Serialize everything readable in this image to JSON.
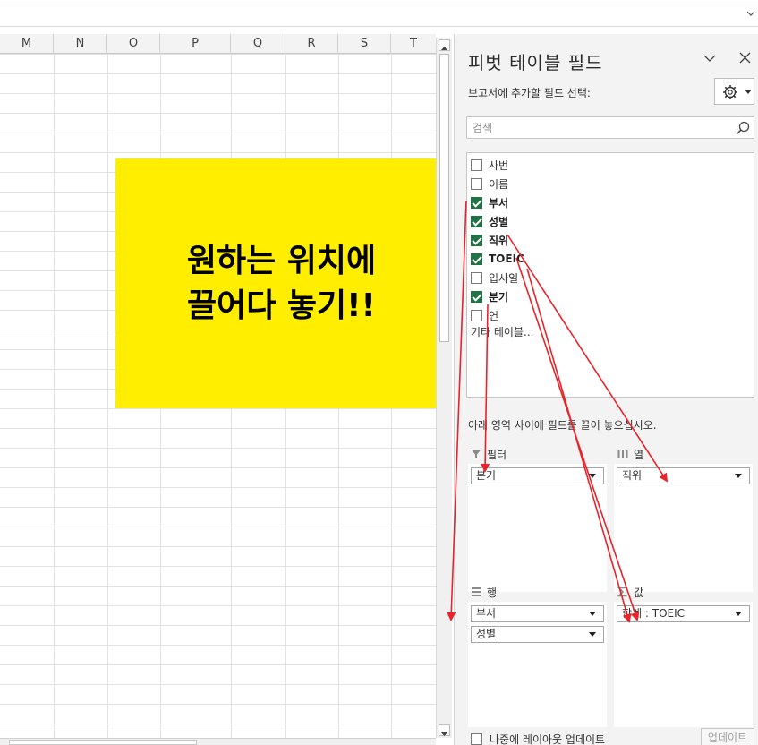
{
  "grid": {
    "columns": [
      "M",
      "N",
      "O",
      "P",
      "Q",
      "R",
      "S",
      "T"
    ]
  },
  "note": {
    "line1": "원하는 위치에",
    "line2": "끌어다 놓기!!"
  },
  "pane": {
    "title": "피벗 테이블 필드",
    "subtitle": "보고서에 추가할 필드 선택:",
    "search_placeholder": "검색",
    "fields": [
      {
        "label": "사번",
        "checked": false
      },
      {
        "label": "이름",
        "checked": false
      },
      {
        "label": "부서",
        "checked": true
      },
      {
        "label": "성별",
        "checked": true
      },
      {
        "label": "직위",
        "checked": true
      },
      {
        "label": "TOEIC",
        "checked": true
      },
      {
        "label": "입사일",
        "checked": false
      },
      {
        "label": "분기",
        "checked": true
      },
      {
        "label": "연",
        "checked": false
      }
    ],
    "more_tables": "기타 테이블...",
    "drag_hint": "아래 영역 사이에 필드를 끌어 놓으십시오.",
    "areas": {
      "filter": {
        "title": "필터",
        "items": [
          "분기"
        ]
      },
      "columns": {
        "title": "열",
        "items": [
          "직위"
        ]
      },
      "rows": {
        "title": "행",
        "items": [
          "부서",
          "성별"
        ]
      },
      "values": {
        "title": "값",
        "items": [
          "합계 : TOEIC"
        ]
      }
    },
    "defer_label": "나중에 레이아웃 업데이트",
    "defer_checked": false,
    "update_button": "업데이트"
  },
  "colors": {
    "note_bg": "#ffee00",
    "check_green": "#217346",
    "arrow_red": "#e8232a"
  }
}
